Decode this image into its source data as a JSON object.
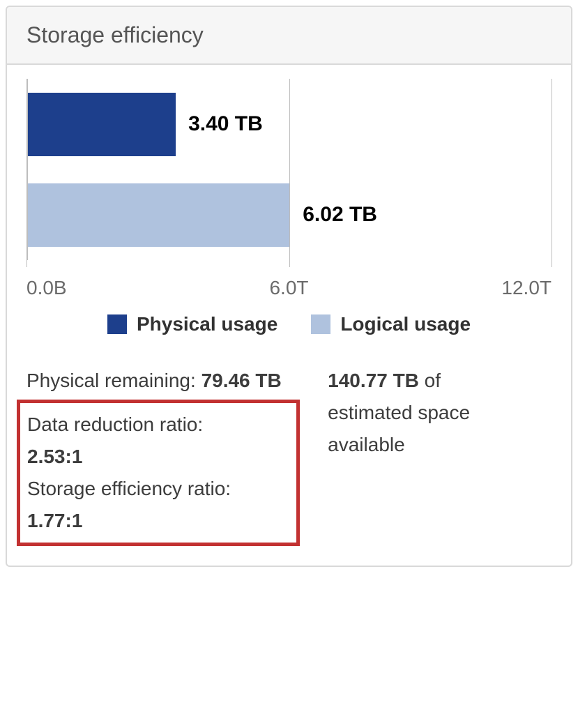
{
  "header": {
    "title": "Storage efficiency"
  },
  "chart_data": {
    "type": "bar",
    "orientation": "horizontal",
    "xmin": 0,
    "xmax": 12,
    "xunit": "T",
    "series": [
      {
        "name": "Physical usage",
        "value": 3.4,
        "value_label": "3.40 TB",
        "color": "#1d3f8c"
      },
      {
        "name": "Logical usage",
        "value": 6.02,
        "value_label": "6.02 TB",
        "color": "#afc2de"
      }
    ],
    "ticks": [
      {
        "pos": 0,
        "label": "0.0B"
      },
      {
        "pos": 6,
        "label": "6.0T"
      },
      {
        "pos": 12,
        "label": "12.0T"
      }
    ],
    "legend": [
      {
        "name": "Physical usage",
        "color": "#1d3f8c"
      },
      {
        "name": "Logical usage",
        "color": "#afc2de"
      }
    ]
  },
  "stats": {
    "physical_remaining_label": "Physical remaining: ",
    "physical_remaining_value": "79.46 TB",
    "data_reduction_label": "Data reduction ratio:",
    "data_reduction_value": "2.53:1",
    "storage_efficiency_label": "Storage efficiency ratio:",
    "storage_efficiency_value": "1.77:1",
    "estimated_value": "140.77 TB",
    "estimated_suffix1": " of",
    "estimated_line2": "estimated space",
    "estimated_line3": "available"
  }
}
